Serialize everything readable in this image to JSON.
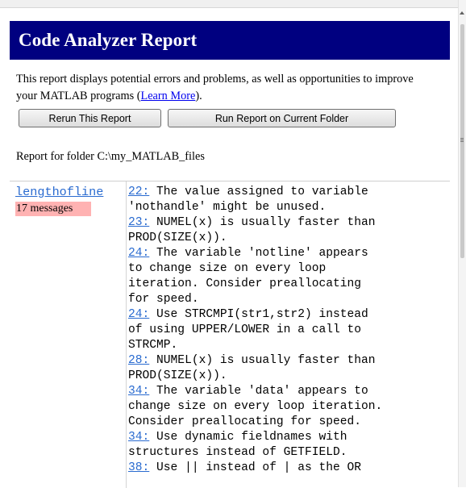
{
  "report": {
    "title": "Code Analyzer Report",
    "description_before": "This report displays potential errors and problems, as well as opportunities to improve your MATLAB programs (",
    "learn_more": "Learn More",
    "description_after": ").",
    "rerun_label": "Rerun This Report",
    "current_folder_label": "Run Report on Current Folder",
    "folder_text": "Report for folder C:\\my_MATLAB_files"
  },
  "results": {
    "file": "lengthofline",
    "count_label": "17 messages",
    "messages": [
      {
        "line": "22:",
        "text": " The value assigned to variable\n'nothandle' might be unused."
      },
      {
        "line": "23:",
        "text": " NUMEL(x) is usually faster than\nPROD(SIZE(x))."
      },
      {
        "line": "24:",
        "text": " The variable 'notline' appears\nto change size on every loop\niteration. Consider preallocating\nfor speed."
      },
      {
        "line": "24:",
        "text": " Use STRCMPI(str1,str2) instead\nof using UPPER/LOWER in a call to\nSTRCMP."
      },
      {
        "line": "28:",
        "text": " NUMEL(x) is usually faster than\nPROD(SIZE(x))."
      },
      {
        "line": "34:",
        "text": " The variable 'data' appears to\nchange size on every loop iteration.\nConsider preallocating for speed."
      },
      {
        "line": "34:",
        "text": " Use dynamic fieldnames with\nstructures instead of GETFIELD."
      },
      {
        "line": "38:",
        "text": " Use || instead of | as the OR"
      }
    ]
  },
  "colors": {
    "title_bg": "#000080",
    "link": "#2a6bd0",
    "badge_bg": "#ffb2b2"
  }
}
